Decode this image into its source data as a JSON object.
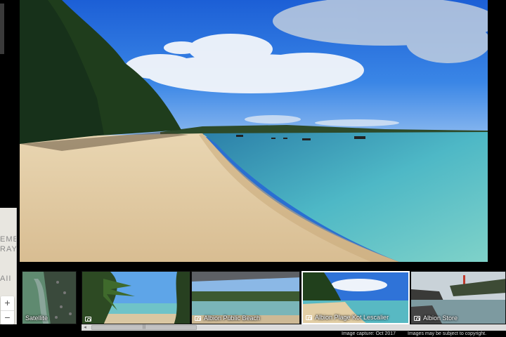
{
  "zoom": {
    "in_label": "+",
    "out_label": "−"
  },
  "minimap": {
    "text_lines": [
      "EME",
      "RAY",
      "",
      "",
      "AII"
    ]
  },
  "thumbnails": [
    {
      "caption": "Satellite",
      "has_camera": false
    },
    {
      "caption": "",
      "has_camera": true
    },
    {
      "caption": "Albion Public Beach",
      "has_camera": true
    },
    {
      "caption": "Albion Plage Kot Lescalier",
      "has_camera": true,
      "selected": true
    },
    {
      "caption": "Albion Store",
      "has_camera": true
    }
  ],
  "scrollbar": {
    "left_arrow": "◂",
    "grip": "|||"
  },
  "footer": {
    "capture": "Image capture: Oct 2017",
    "copyright": "Images may be subject to copyright."
  }
}
